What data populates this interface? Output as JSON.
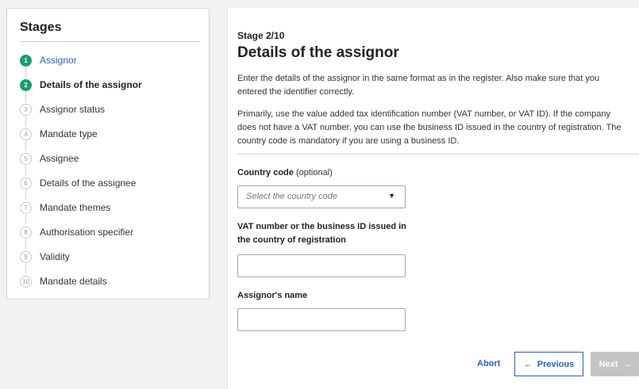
{
  "sidebar": {
    "title": "Stages",
    "stages": [
      {
        "num": "1",
        "label": "Assignor"
      },
      {
        "num": "2",
        "label": "Details of the assignor"
      },
      {
        "num": "3",
        "label": "Assignor status"
      },
      {
        "num": "4",
        "label": "Mandate type"
      },
      {
        "num": "5",
        "label": "Assignee"
      },
      {
        "num": "6",
        "label": "Details of the assignee"
      },
      {
        "num": "7",
        "label": "Mandate themes"
      },
      {
        "num": "8",
        "label": "Authorisation specifier"
      },
      {
        "num": "9",
        "label": "Validity"
      },
      {
        "num": "10",
        "label": "Mandate details"
      }
    ]
  },
  "main": {
    "stage_counter": "Stage 2/10",
    "title": "Details of the assignor",
    "paragraph1": "Enter the details of the assignor in the same format as in the register. Also make sure that you entered the identifier correctly.",
    "paragraph2": "Primarily, use the value added tax identification number (VAT number, or VAT ID). If the company does not have a VAT number, you can use the business ID issued in the country of registration. The country code is mandatory if you are using a business ID.",
    "country_label": "Country code",
    "country_optional": "(optional)",
    "country_placeholder": "Select the country code",
    "vat_label": "VAT number or the business ID issued in the country of registration",
    "vat_value": "",
    "name_label": "Assignor's name",
    "name_value": ""
  },
  "actions": {
    "abort": "Abort",
    "previous": "Previous",
    "next": "Next"
  },
  "colors": {
    "accent_green": "#1d9a72",
    "link_blue": "#2a62b4",
    "disabled_gray": "#c4c4c4"
  }
}
